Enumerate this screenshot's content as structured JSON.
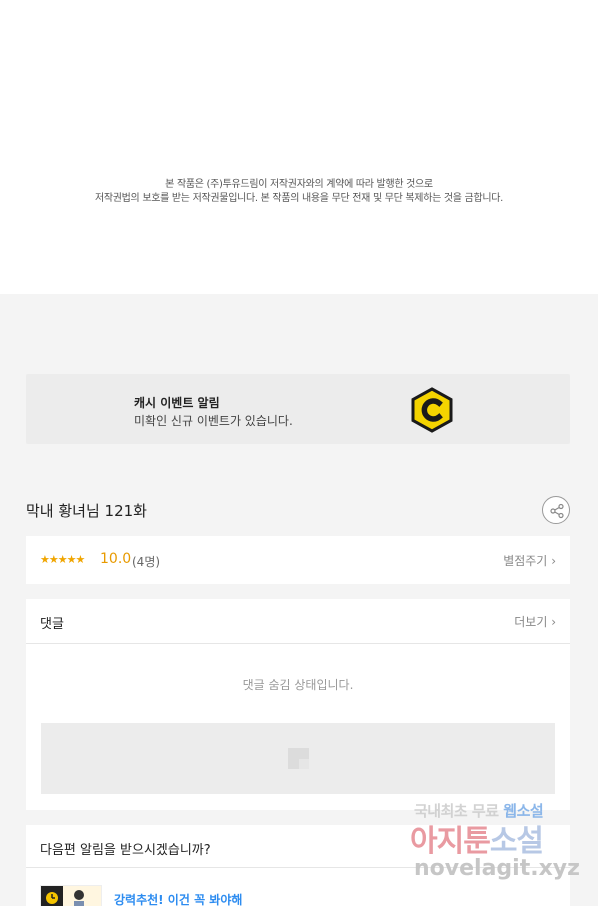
{
  "copyright": {
    "line1": "본 작품은 (주)투유드림이 저작권자와의 계약에 따라 발행한 것으로",
    "line2": "저작권법의 보호를 받는 저작권물입니다. 본 작품의 내용을 무단 전재 및 무단 복제하는 것을 금합니다."
  },
  "cash_event": {
    "title": "캐시 이벤트 알림",
    "description": "미확인 신규 이벤트가 있습니다.",
    "icon": "cash-coin-icon",
    "colors": {
      "coin": "#f5d400",
      "coin_border": "#1a1a1a"
    }
  },
  "episode": {
    "title": "막내 황녀님 121화"
  },
  "rating": {
    "stars": "★★★★★",
    "value": "10.0",
    "count": "(4명)",
    "rate_link": "별점주기",
    "colors": {
      "accent": "#e89a00"
    }
  },
  "comments": {
    "title": "댓글",
    "more_link": "더보기",
    "hidden_message": "댓글 숨김 상태입니다."
  },
  "notify": {
    "question": "다음편 알림을 받으시겠습니까?",
    "recommend_text": "강력추천! 이건 꼭 봐야해"
  },
  "watermark": {
    "line1_a": "국내최초 무료",
    "line1_b": "웹소설",
    "line2_a": "아지툰",
    "line2_b": "소설",
    "line3": "novelagit.xyz"
  }
}
